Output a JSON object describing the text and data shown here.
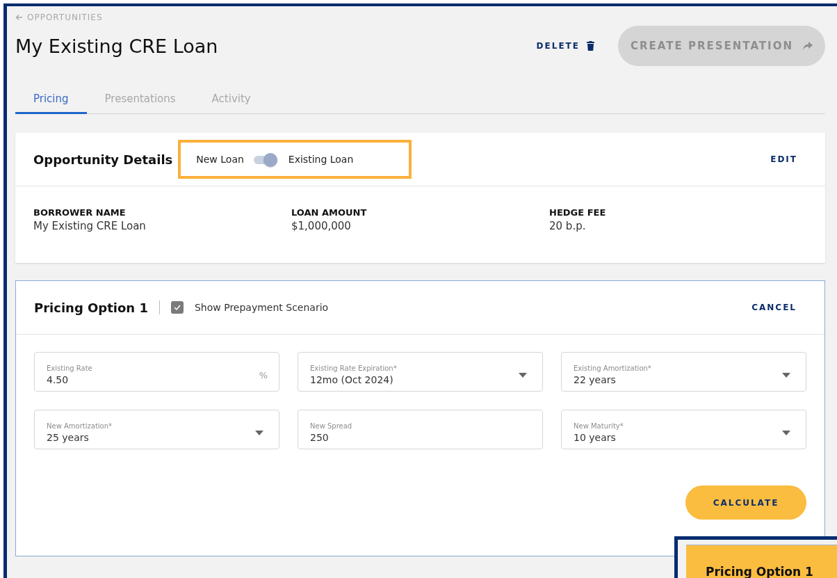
{
  "breadcrumb": {
    "label": "OPPORTUNITIES"
  },
  "title": "My Existing CRE Loan",
  "actions": {
    "delete": "DELETE",
    "create": {
      "label": "CREATE PRESENTATION",
      "disabled": true
    }
  },
  "tabs": [
    {
      "label": "Pricing",
      "selected": true
    },
    {
      "label": "Presentations",
      "selected": false
    },
    {
      "label": "Activity",
      "selected": false
    }
  ],
  "details": {
    "title": "Opportunity Details",
    "toggle": {
      "off_label": "New Loan",
      "on_label": "Existing Loan",
      "on": true,
      "highlighted": true
    },
    "edit": "EDIT",
    "fields": [
      {
        "label": "BORROWER NAME",
        "value": "My Existing CRE Loan"
      },
      {
        "label": "LOAN AMOUNT",
        "value": "$1,000,000"
      },
      {
        "label": "HEDGE FEE",
        "value": "20 b.p."
      }
    ]
  },
  "pricing": {
    "title": "Pricing Option 1",
    "prepayment": {
      "label": "Show Prepayment Scenario",
      "checked": true
    },
    "cancel": "CANCEL",
    "fields": [
      {
        "kind": "input",
        "label": "Existing Rate",
        "value": "4.50",
        "suffix": "%"
      },
      {
        "kind": "select",
        "label": "Existing Rate Expiration*",
        "value": "12mo (Oct 2024)"
      },
      {
        "kind": "select",
        "label": "Existing Amortization*",
        "value": "22 years"
      },
      {
        "kind": "select",
        "label": "New Amortization*",
        "value": "25 years"
      },
      {
        "kind": "input",
        "label": "New Spread",
        "value": "250"
      },
      {
        "kind": "select",
        "label": "New Maturity*",
        "value": "10 years"
      }
    ],
    "calculate": "CALCULATE"
  },
  "inset": {
    "title": "Pricing Option 1"
  }
}
